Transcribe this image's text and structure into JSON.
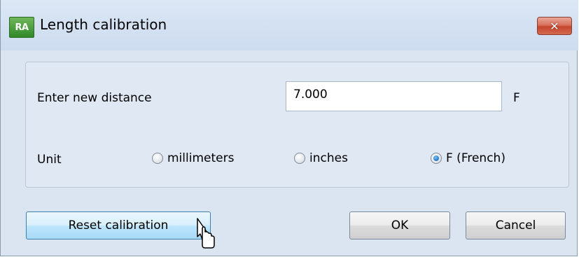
{
  "window": {
    "title": "Length calibration",
    "app_icon_text": "RA",
    "close_symbol": "✕"
  },
  "distance": {
    "label": "Enter new distance",
    "value": "7.000",
    "unit_suffix": "F"
  },
  "unit": {
    "label": "Unit",
    "options": [
      {
        "label": "millimeters",
        "selected": false
      },
      {
        "label": "inches",
        "selected": false
      },
      {
        "label": "F (French)",
        "selected": true
      }
    ]
  },
  "buttons": {
    "reset_label": "Reset calibration",
    "ok_label": "OK",
    "cancel_label": "Cancel"
  },
  "icons": {
    "app": "app-logo-icon",
    "close": "close-icon",
    "cursor": "mouse-pointer-icon"
  }
}
